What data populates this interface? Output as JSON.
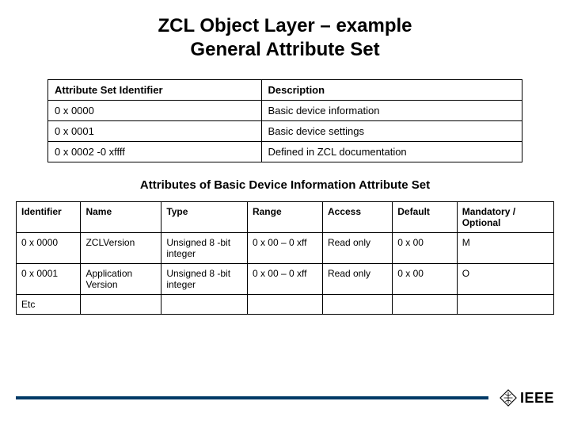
{
  "title_line1": "ZCL Object Layer – example",
  "title_line2": "General Attribute Set",
  "table1": {
    "headers": [
      "Attribute Set Identifier",
      "Description"
    ],
    "rows": [
      [
        "0 x 0000",
        "Basic device information"
      ],
      [
        "0 x 0001",
        "Basic device settings"
      ],
      [
        "0 x 0002 -0 xffff",
        "Defined in ZCL documentation"
      ]
    ]
  },
  "subtitle": "Attributes of Basic Device Information Attribute Set",
  "table2": {
    "headers": [
      "Identifier",
      "Name",
      "Type",
      "Range",
      "Access",
      "Default",
      "Mandatory / Optional"
    ],
    "rows": [
      [
        "0 x 0000",
        "ZCLVersion",
        "Unsigned 8 -bit integer",
        "0 x 00 – 0 xff",
        "Read only",
        "0 x 00",
        "M"
      ],
      [
        "0 x 0001",
        "Application Version",
        "Unsigned 8 -bit integer",
        "0 x 00 – 0 xff",
        "Read only",
        "0 x 00",
        "O"
      ],
      [
        "Etc",
        "",
        "",
        "",
        "",
        "",
        ""
      ]
    ]
  },
  "logo_text": "IEEE"
}
